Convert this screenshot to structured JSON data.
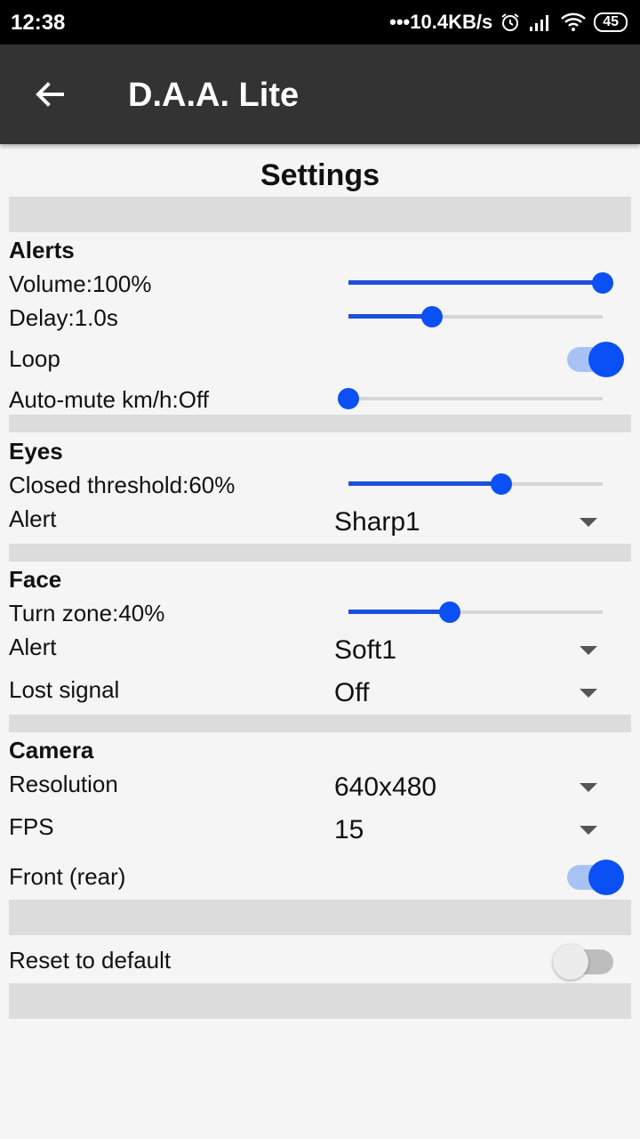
{
  "status_bar": {
    "time": "12:38",
    "network_speed": "•••10.4KB/s",
    "battery": "45",
    "icons": [
      "alarm-icon",
      "signal-icon",
      "wifi-icon",
      "battery-icon"
    ]
  },
  "app_bar": {
    "title": "D.A.A. Lite",
    "back_icon": "arrow-left-icon"
  },
  "page": {
    "heading": "Settings"
  },
  "alerts": {
    "title": "Alerts",
    "volume": {
      "label": "Volume:100%",
      "value": 1.0
    },
    "delay": {
      "label": "Delay:1.0s",
      "value": 0.33
    },
    "loop": {
      "label": "Loop",
      "on": true
    },
    "auto_mute": {
      "label": "Auto-mute km/h:Off",
      "value": 0.0
    }
  },
  "eyes": {
    "title": "Eyes",
    "closed_threshold": {
      "label": "Closed threshold:60%",
      "value": 0.6
    },
    "alert": {
      "label": "Alert",
      "value": "Sharp1"
    }
  },
  "face": {
    "title": "Face",
    "turn_zone": {
      "label": "Turn zone:40%",
      "value": 0.4
    },
    "alert": {
      "label": "Alert",
      "value": "Soft1"
    },
    "lost_signal": {
      "label": "Lost signal",
      "value": "Off"
    }
  },
  "camera": {
    "title": "Camera",
    "resolution": {
      "label": "Resolution",
      "value": "640x480"
    },
    "fps": {
      "label": "FPS",
      "value": "15"
    },
    "front": {
      "label": "Front (rear)",
      "on": true
    }
  },
  "reset": {
    "label": "Reset to default",
    "on": false
  },
  "colors": {
    "accent": "#0b50f5",
    "appbar": "#333333",
    "band": "#dcdcdc"
  }
}
